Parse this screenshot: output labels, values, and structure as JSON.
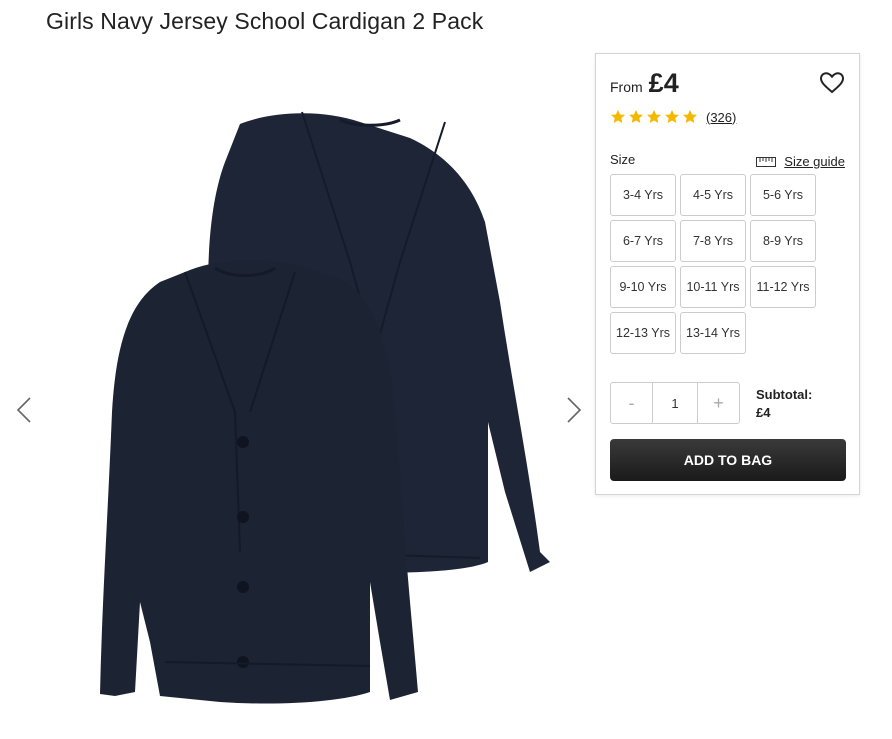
{
  "product": {
    "title": "Girls Navy Jersey School Cardigan 2 Pack"
  },
  "gallery": {
    "image_icon": "navy-cardigan-image",
    "prev_icon": "chevron-left-icon",
    "next_icon": "chevron-right-icon",
    "garment_color": "#1c2333"
  },
  "pricing": {
    "from_label": "From",
    "price": "£4"
  },
  "rating": {
    "stars": 5,
    "max_stars": 5,
    "star_color": "#f5b800",
    "review_count": "(326)"
  },
  "size": {
    "label": "Size",
    "guide_label": "Size guide",
    "guide_icon": "ruler-icon",
    "options": [
      "3-4 Yrs",
      "4-5 Yrs",
      "5-6 Yrs",
      "6-7 Yrs",
      "7-8 Yrs",
      "8-9 Yrs",
      "9-10 Yrs",
      "10-11 Yrs",
      "11-12 Yrs",
      "12-13 Yrs",
      "13-14 Yrs"
    ]
  },
  "quantity": {
    "minus_label": "-",
    "value": "1",
    "plus_label": "+"
  },
  "subtotal": {
    "label": "Subtotal:",
    "value": "£4"
  },
  "actions": {
    "add_to_bag_label": "ADD TO BAG",
    "wishlist_icon": "heart-icon",
    "button_color": "#222222"
  }
}
